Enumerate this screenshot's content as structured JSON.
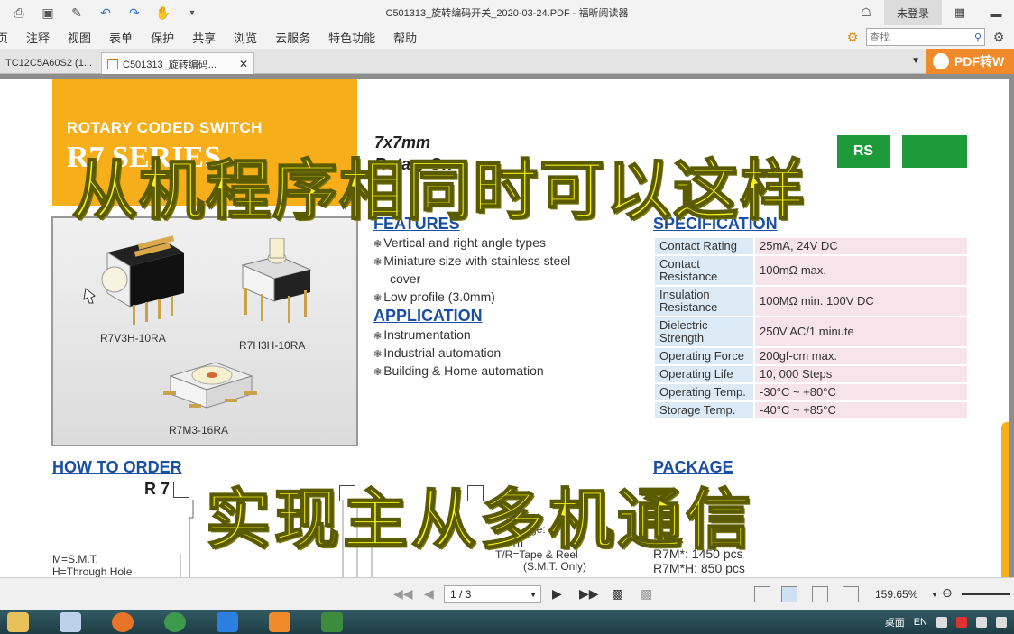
{
  "window": {
    "title": "C501313_旋转编码开关_2020-03-24.PDF - 福昕阅读器",
    "login_label": "未登录"
  },
  "menu": {
    "items": [
      "页",
      "注释",
      "视图",
      "表单",
      "保护",
      "共享",
      "浏览",
      "云服务",
      "特色功能",
      "帮助"
    ],
    "search_placeholder": "查找"
  },
  "tabs": [
    {
      "label": "TC12C5A60S2 (1..."
    },
    {
      "label": "C501313_旋转编码..."
    }
  ],
  "pdf_convert_label": "PDF转W",
  "document": {
    "header_sub": "ROTARY CODED SWITCH",
    "header_series": "R7 SERIES",
    "size_title": "7x7mm",
    "size_title2": "Rotary Sw",
    "rohs": "RS",
    "products": [
      {
        "label": "R7V3H-10RA"
      },
      {
        "label": "R7H3H-10RA"
      },
      {
        "label": "R7M3-16RA"
      }
    ],
    "features": {
      "heading": "FEATURES",
      "items": [
        "Vertical and right angle types",
        "Miniature size with stainless steel",
        "cover",
        "Low profile (3.0mm)"
      ]
    },
    "application": {
      "heading": "APPLICATION",
      "items": [
        "Instrumentation",
        "Industrial automation",
        "Building & Home automation"
      ]
    },
    "specification": {
      "heading": "SPECIFICATION",
      "rows": [
        {
          "k": "Contact Rating",
          "v": "25mA, 24V DC"
        },
        {
          "k": "Contact Resistance",
          "v": "100mΩ max."
        },
        {
          "k": "Insulation Resistance",
          "v": "100MΩ min. 100V DC"
        },
        {
          "k": "Dielectric Strength",
          "v": "250V AC/1 minute"
        },
        {
          "k": "Operating Force",
          "v": "200gf-cm max."
        },
        {
          "k": "Operating Life",
          "v": "10, 000 Steps"
        },
        {
          "k": "Operating Temp.",
          "v": "-30°C ~ +80°C"
        },
        {
          "k": "Storage Temp.",
          "v": "-40°C ~ +85°C"
        }
      ]
    },
    "how_to_order": {
      "heading": "HOW TO ORDER",
      "code": "R 7",
      "smt": "M=S.M.T.",
      "through": "H=Through Hole",
      "package_word": "ge:",
      "tube": "T=Tu",
      "tape": "T/R=Tape & Reel",
      "smt_only": "(S.M.T. Only)"
    },
    "package": {
      "heading": "PACKAGE",
      "line1": "R7M*: 1450 pcs",
      "line2": "R7M*H: 850 pcs"
    },
    "overlay": {
      "line1": "从机程序相同时可以这样",
      "line2": "实现主从多机通信"
    }
  },
  "status": {
    "page_indicator": "1 / 3",
    "zoom": "159.65%"
  },
  "taskbar": {
    "desktop_label": "桌面",
    "lang": "EN"
  },
  "colors": {
    "accent_orange": "#f7ae1b",
    "heading_blue": "#1a4fa3",
    "overlay_yellow": "#f7f21c"
  }
}
